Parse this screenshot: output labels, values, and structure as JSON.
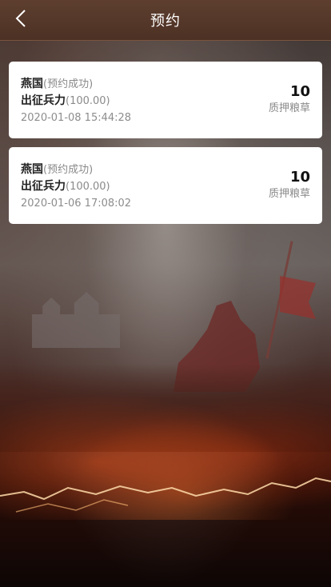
{
  "header": {
    "title": "预约",
    "back_icon": "chevron-left-icon"
  },
  "colors": {
    "header_bg": "#55382a",
    "card_bg": "#ffffff",
    "text_primary": "#222222",
    "text_muted": "#8a8a8a"
  },
  "records": [
    {
      "kingdom": "燕国",
      "status": "(预约成功)",
      "force_label": "出征兵力",
      "force_value": "(100.00)",
      "datetime": "2020-01-08 15:44:28",
      "amount": "10",
      "amount_label": "质押粮草"
    },
    {
      "kingdom": "燕国",
      "status": "(预约成功)",
      "force_label": "出征兵力",
      "force_value": "(100.00)",
      "datetime": "2020-01-06 17:08:02",
      "amount": "10",
      "amount_label": "质押粮草"
    }
  ]
}
